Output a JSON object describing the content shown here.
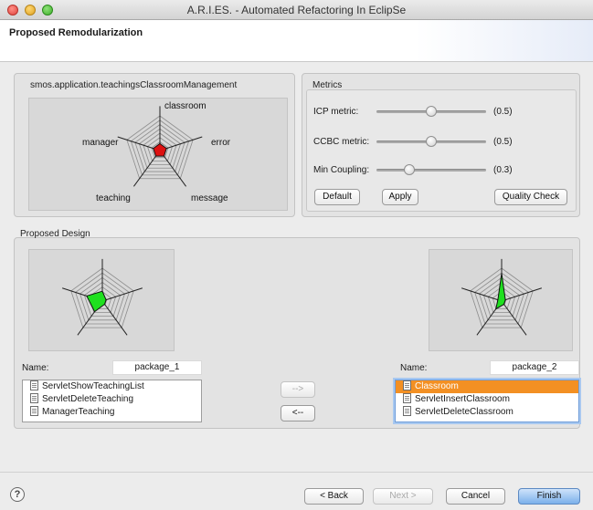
{
  "window": {
    "title": "A.R.I.ES. - Automated Refactoring In EclipSe"
  },
  "header": {
    "title": "Proposed Remodularization"
  },
  "package_panel": {
    "title": "smos.application.teachingsClassroomManagement",
    "axes": [
      "classroom",
      "error",
      "message",
      "teaching",
      "manager"
    ],
    "fill_color": "#dd1111"
  },
  "metrics": {
    "title": "Metrics",
    "items": [
      {
        "label": "ICP metric:",
        "value_text": "(0.5)",
        "value": 0.5
      },
      {
        "label": "CCBC metric:",
        "value_text": "(0.5)",
        "value": 0.5
      },
      {
        "label": "Min Coupling:",
        "value_text": "(0.3)",
        "value": 0.3
      }
    ],
    "default_label": "Default",
    "apply_label": "Apply",
    "quality_label": "Quality Check"
  },
  "proposed": {
    "title": "Proposed Design",
    "fill_color": "#1fe01f",
    "left": {
      "name_label": "Name:",
      "name_value": "package_1",
      "classes": [
        "ServletShowTeachingList",
        "ServletDeleteTeaching",
        "ManagerTeaching"
      ]
    },
    "right": {
      "name_label": "Name:",
      "name_value": "package_2",
      "classes": [
        "Classroom",
        "ServletInsertClassroom",
        "ServletDeleteClassroom"
      ],
      "selected_index": 0
    },
    "move_right_label": "-->",
    "move_left_label": "<--"
  },
  "footer": {
    "help_label": "?",
    "back_label": "< Back",
    "next_label": "Next >",
    "cancel_label": "Cancel",
    "finish_label": "Finish"
  }
}
